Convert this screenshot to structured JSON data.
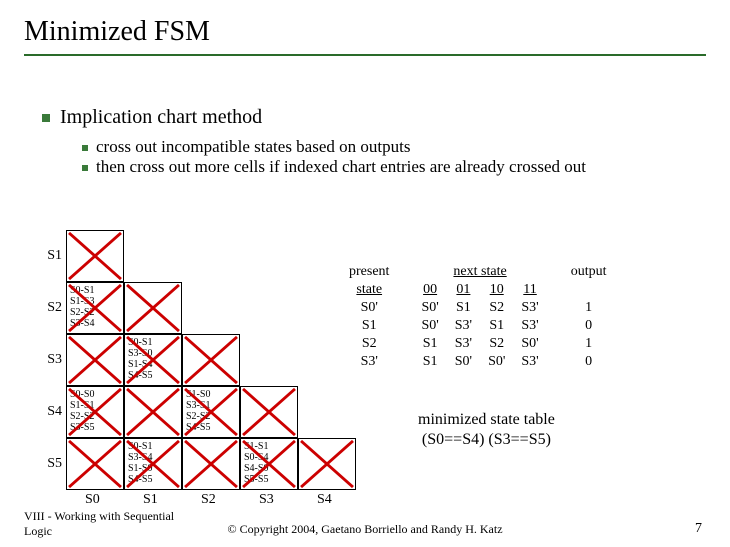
{
  "title": "Minimized FSM",
  "bullets": {
    "main": "Implication chart method",
    "sub1": "cross out incompatible states based on outputs",
    "sub2": "then cross out more cells if indexed chart entries are already crossed out"
  },
  "chart": {
    "row_labels": [
      "S1",
      "S2",
      "S3",
      "S4",
      "S5"
    ],
    "col_labels": [
      "S0",
      "S1",
      "S2",
      "S3",
      "S4"
    ],
    "cells": {
      "r1c0": {
        "x": true
      },
      "r2c0": {
        "x": true,
        "text": "S0-S1\nS1-S3\nS2-S2\nS3-S4"
      },
      "r2c1": {
        "x": true
      },
      "r3c0": {
        "x": true
      },
      "r3c1": {
        "x": true,
        "text": "S0-S1\nS3-S0\nS1-S4\nS4-S5"
      },
      "r3c2": {
        "x": true
      },
      "r4c0": {
        "x": true,
        "text": "S0-S0\nS1-S1\nS2-S2\nS3-S5"
      },
      "r4c1": {
        "x": true
      },
      "r4c2": {
        "x": true,
        "text": "S1-S0\nS3-S1\nS2-S2\nS4-S5"
      },
      "r4c3": {
        "x": true
      },
      "r5c0": {
        "x": true
      },
      "r5c1": {
        "x": true,
        "text": "S0-S1\nS3-S4\nS1-S0\nS4-S5"
      },
      "r5c2": {
        "x": true
      },
      "r5c3": {
        "x": true,
        "text": "S1-S1\nS0-S4\nS4-S0\nS5-S5"
      },
      "r5c4": {
        "x": true
      }
    }
  },
  "state_table": {
    "header_present": "present",
    "header_state": "state",
    "header_next": "next state",
    "header_output": "output",
    "cols": [
      "00",
      "01",
      "10",
      "11"
    ],
    "rows": [
      {
        "state": "S0'",
        "next": [
          "S0'",
          "S1",
          "S2",
          "S3'"
        ],
        "out": "1"
      },
      {
        "state": "S1",
        "next": [
          "S0'",
          "S3'",
          "S1",
          "S3'"
        ],
        "out": "0"
      },
      {
        "state": "S2",
        "next": [
          "S1",
          "S3'",
          "S2",
          "S0'"
        ],
        "out": "1"
      },
      {
        "state": "S3'",
        "next": [
          "S1",
          "S0'",
          "S0'",
          "S3'"
        ],
        "out": "0"
      }
    ]
  },
  "minimized": {
    "line1": "minimized state table",
    "line2": "(S0==S4) (S3==S5)"
  },
  "footer": {
    "left_line1": "VIII - Working with Sequential",
    "left_line2": "Logic",
    "center": "© Copyright 2004, Gaetano Borriello and Randy H. Katz",
    "page": "7"
  }
}
